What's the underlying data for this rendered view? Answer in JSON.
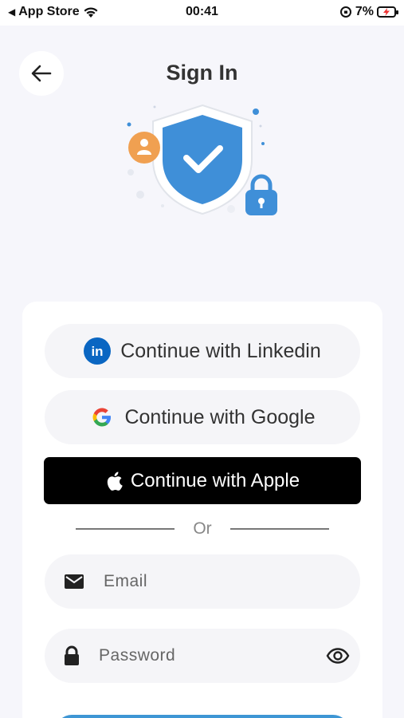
{
  "status_bar": {
    "back_app": "App Store",
    "time": "00:41",
    "battery_percent": "7%"
  },
  "header": {
    "title": "Sign In"
  },
  "social": {
    "linkedin_label": "Continue with Linkedin",
    "linkedin_icon_text": "in",
    "google_label": "Continue with Google",
    "apple_label": "Continue with Apple"
  },
  "divider": {
    "text": "Or"
  },
  "form": {
    "email_placeholder": "Email",
    "email_value": "",
    "password_placeholder": "Password",
    "password_value": ""
  },
  "colors": {
    "primary": "#3e96d4",
    "shield": "#3f8fd8",
    "avatar": "#f0a051",
    "linkedin": "#0a66c2"
  },
  "icons": [
    "back-arrow-icon",
    "wifi-icon",
    "orientation-lock-icon",
    "battery-charging-icon",
    "linkedin-icon",
    "google-icon",
    "apple-icon",
    "mail-icon",
    "lock-icon",
    "eye-icon"
  ]
}
